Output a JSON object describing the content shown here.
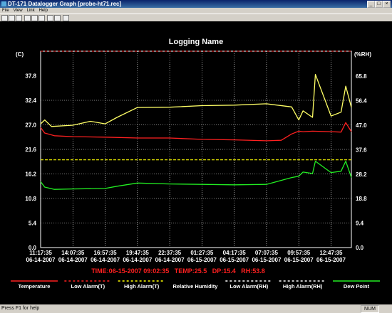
{
  "window": {
    "title": "DT-171 Datalogger Graph [probe-ht71.rec]",
    "menu": [
      "File",
      "View",
      "Link",
      "Help"
    ]
  },
  "status": {
    "help_text": "Press F1 for help",
    "num_indicator": "NUM"
  },
  "readout": "TIME:06-15-2007 09:02:35   TEMP:25.5   DP:15.4   RH:53.8",
  "colors": {
    "temperature": "#ff2020",
    "relative_humidity": "#ffff66",
    "dew_point": "#22ee22",
    "alarm_line": "#ffff00",
    "grid": "#ffffff",
    "readout": "#ff2020",
    "background": "#000000"
  },
  "chart_data": {
    "type": "line",
    "title": "Logging Name",
    "left_axis_label": "(C)",
    "right_axis_label": "(%RH)",
    "left_ylim": [
      0.0,
      43.2
    ],
    "right_ylim": [
      0.0,
      75.4
    ],
    "left_ticks": [
      "37.8",
      "32.4",
      "27.0",
      "21.6",
      "16.2",
      "10.8",
      "5.4",
      "0.0"
    ],
    "right_ticks": [
      "65.8",
      "56.4",
      "47.0",
      "37.6",
      "28.2",
      "18.8",
      "9.4",
      "0.0"
    ],
    "x_ticks": [
      {
        "time": "11:17:35",
        "date": "06-14-2007"
      },
      {
        "time": "14:07:35",
        "date": "06-14-2007"
      },
      {
        "time": "16:57:35",
        "date": "06-14-2007"
      },
      {
        "time": "19:47:35",
        "date": "06-14-2007"
      },
      {
        "time": "22:37:35",
        "date": "06-14-2007"
      },
      {
        "time": "01:27:35",
        "date": "06-15-2007"
      },
      {
        "time": "04:17:35",
        "date": "06-15-2007"
      },
      {
        "time": "07:07:35",
        "date": "06-15-2007"
      },
      {
        "time": "09:57:35",
        "date": "06-15-2007"
      },
      {
        "time": "12:47:35",
        "date": "06-15-2007"
      }
    ],
    "x_start": "06-14-2007 11:17:35",
    "x_end": "06-15-2007 14:34:35",
    "grid": true,
    "legend_position": "bottom",
    "alarm_levels": {
      "low_alarm_T": 43.2,
      "high_alarm_T": 19.3
    },
    "series": [
      {
        "name": "Temperature",
        "axis": "left",
        "color": "#ff2020",
        "x": [
          "06-14-2007 11:17:35",
          "06-14-2007 11:39:00",
          "06-14-2007 12:30:00",
          "06-14-2007 14:07:35",
          "06-14-2007 16:57:35",
          "06-14-2007 19:47:35",
          "06-14-2007 22:37:35",
          "06-15-2007 01:27:35",
          "06-15-2007 04:17:35",
          "06-15-2007 07:07:35",
          "06-15-2007 08:25:00",
          "06-15-2007 09:20:00",
          "06-15-2007 09:57:35",
          "06-15-2007 10:20:00",
          "06-15-2007 11:10:00",
          "06-15-2007 12:47:35",
          "06-15-2007 13:40:00",
          "06-15-2007 14:05:00",
          "06-15-2007 14:34:35"
        ],
        "values": [
          26.4,
          25.2,
          24.6,
          24.4,
          24.3,
          24.1,
          24.1,
          23.8,
          23.7,
          23.5,
          23.6,
          25.0,
          25.6,
          25.5,
          25.6,
          25.5,
          25.4,
          27.5,
          25.5
        ]
      },
      {
        "name": "Relative Humidity",
        "axis": "right",
        "color": "#ffff66",
        "x": [
          "06-14-2007 11:17:35",
          "06-14-2007 11:39:00",
          "06-14-2007 12:15:00",
          "06-14-2007 14:07:35",
          "06-14-2007 15:40:00",
          "06-14-2007 16:57:35",
          "06-14-2007 18:00:00",
          "06-14-2007 19:47:35",
          "06-14-2007 22:37:35",
          "06-15-2007 01:27:35",
          "06-15-2007 04:17:35",
          "06-15-2007 07:07:35",
          "06-15-2007 09:20:00",
          "06-15-2007 09:57:35",
          "06-15-2007 10:20:00",
          "06-15-2007 11:10:00",
          "06-15-2007 11:25:00",
          "06-15-2007 12:47:35",
          "06-15-2007 13:40:00",
          "06-15-2007 14:05:00",
          "06-15-2007 14:34:35"
        ],
        "values": [
          47.5,
          49.0,
          46.5,
          47.0,
          48.5,
          47.5,
          50.0,
          53.8,
          53.9,
          54.5,
          54.7,
          55.2,
          54.0,
          49.0,
          52.5,
          50.0,
          66.5,
          50.5,
          52.0,
          62.0,
          53.8
        ]
      },
      {
        "name": "Dew Point",
        "axis": "left",
        "color": "#22ee22",
        "x": [
          "06-14-2007 11:17:35",
          "06-14-2007 11:39:00",
          "06-14-2007 12:30:00",
          "06-14-2007 14:07:35",
          "06-14-2007 16:57:35",
          "06-14-2007 18:00:00",
          "06-14-2007 19:47:35",
          "06-14-2007 22:37:35",
          "06-15-2007 01:27:35",
          "06-15-2007 04:17:35",
          "06-15-2007 07:07:35",
          "06-15-2007 09:20:00",
          "06-15-2007 09:57:35",
          "06-15-2007 10:20:00",
          "06-15-2007 11:10:00",
          "06-15-2007 11:25:00",
          "06-15-2007 12:47:35",
          "06-15-2007 13:40:00",
          "06-15-2007 14:05:00",
          "06-15-2007 14:34:35"
        ],
        "values": [
          14.5,
          13.3,
          12.8,
          12.9,
          13.0,
          13.5,
          14.2,
          14.0,
          13.9,
          13.8,
          13.9,
          15.4,
          15.7,
          16.6,
          16.3,
          19.0,
          16.5,
          16.8,
          19.0,
          15.4
        ]
      }
    ],
    "legend": [
      {
        "label": "Temperature",
        "style": "solid",
        "color": "#ff2020"
      },
      {
        "label": "Low Alarm(T)",
        "style": "dashed",
        "color": "#ff2020"
      },
      {
        "label": "High Alarm(T)",
        "style": "dashed",
        "color": "#ffff00"
      },
      {
        "label": "Relative Humidity",
        "style": "none",
        "color": "#ffff66"
      },
      {
        "label": "Low Alarm(RH)",
        "style": "dashed",
        "color": "#ffffff"
      },
      {
        "label": "High Alarm(RH)",
        "style": "dashed",
        "color": "#ffffff"
      },
      {
        "label": "Dew Point",
        "style": "solid",
        "color": "#22ee22"
      }
    ]
  }
}
